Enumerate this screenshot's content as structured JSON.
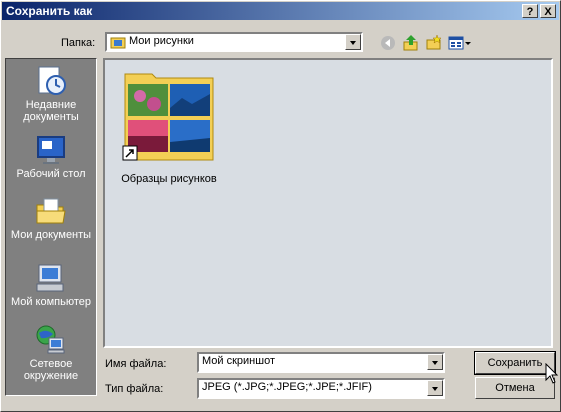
{
  "window": {
    "title": "Сохранить как",
    "help_label": "?",
    "close_label": "X"
  },
  "location": {
    "label": "Папка:",
    "value": "Мои рисунки"
  },
  "toolbar": {
    "icons": [
      "back-icon",
      "up-folder-icon",
      "new-folder-icon",
      "view-menu-icon"
    ]
  },
  "places": [
    {
      "label": "Недавние документы",
      "icon": "recent-documents-icon"
    },
    {
      "label": "Рабочий стол",
      "icon": "desktop-icon"
    },
    {
      "label": "Мои документы",
      "icon": "my-documents-icon"
    },
    {
      "label": "Мой компьютер",
      "icon": "my-computer-icon"
    },
    {
      "label": "Сетевое окружение",
      "icon": "network-icon"
    }
  ],
  "files": [
    {
      "label": "Образцы рисунков",
      "icon": "folder-shortcut-icon"
    }
  ],
  "filename": {
    "label": "Имя файла:",
    "value": "Мой скриншот"
  },
  "filetype": {
    "label": "Тип файла:",
    "value": "JPEG (*.JPG;*.JPEG;*.JPE;*.JFIF)"
  },
  "buttons": {
    "save": "Сохранить",
    "cancel": "Отмена"
  },
  "colors": {
    "title_start": "#0a246a",
    "title_end": "#a6caf0",
    "places_bg": "#808080"
  }
}
